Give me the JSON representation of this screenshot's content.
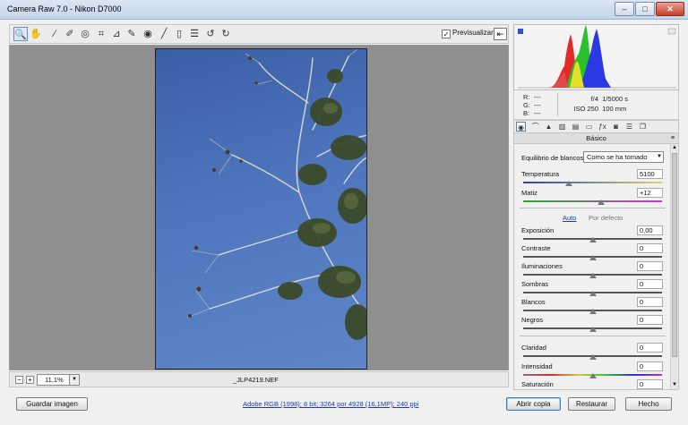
{
  "window": {
    "title": "Camera Raw 7.0 -  Nikon D7000",
    "minimize_glyph": "–",
    "maximize_glyph": "□",
    "close_glyph": "✕"
  },
  "toolbar": {
    "tools": [
      {
        "name": "zoom-tool-icon",
        "glyph": "🔍"
      },
      {
        "name": "hand-tool-icon",
        "glyph": "✋"
      },
      {
        "name": "white-balance-tool-icon",
        "glyph": "⁄"
      },
      {
        "name": "color-sampler-tool-icon",
        "glyph": "✐"
      },
      {
        "name": "target-adjustment-tool-icon",
        "glyph": "◎"
      },
      {
        "name": "crop-tool-icon",
        "glyph": "⌗"
      },
      {
        "name": "straighten-tool-icon",
        "glyph": "⊿"
      },
      {
        "name": "spot-removal-tool-icon",
        "glyph": "✎"
      },
      {
        "name": "red-eye-tool-icon",
        "glyph": "◉"
      },
      {
        "name": "adjustment-brush-icon",
        "glyph": "╱"
      },
      {
        "name": "graduated-filter-icon",
        "glyph": "▯"
      },
      {
        "name": "preferences-icon",
        "glyph": "☰"
      },
      {
        "name": "rotate-left-icon",
        "glyph": "↺"
      },
      {
        "name": "rotate-right-icon",
        "glyph": "↻"
      }
    ],
    "preview_label": "Previsualizar",
    "preview_checked": true,
    "fullscreen_glyph": "⇤"
  },
  "status": {
    "zoom": "11,1%",
    "filename": "_JLP4219.NEF"
  },
  "info": {
    "r_label": "R:",
    "g_label": "G:",
    "b_label": "B:",
    "r_value": "---",
    "g_value": "---",
    "b_value": "---",
    "aperture": "f/4",
    "shutter": "1/5000 s",
    "iso": "ISO 250",
    "focal": "100 mm"
  },
  "panel": {
    "title": "Básico",
    "menu_glyph": "≡",
    "wb_label": "Equilibrio de blancos:",
    "wb_value": "Como se ha tomado",
    "auto_label": "Auto",
    "default_label": "Por defecto",
    "sliders": [
      {
        "label": "Temperatura",
        "value": "5100",
        "level": 0.33,
        "kind": "temp"
      },
      {
        "label": "Matiz",
        "value": "+12",
        "level": 0.56,
        "kind": "tint"
      },
      {
        "label": "Exposición",
        "value": "0,00",
        "level": 0.5,
        "kind": "plain"
      },
      {
        "label": "Contraste",
        "value": "0",
        "level": 0.5,
        "kind": "plain"
      },
      {
        "label": "Iluminaciones",
        "value": "0",
        "level": 0.5,
        "kind": "plain"
      },
      {
        "label": "Sombras",
        "value": "0",
        "level": 0.5,
        "kind": "plain"
      },
      {
        "label": "Blancos",
        "value": "0",
        "level": 0.5,
        "kind": "plain"
      },
      {
        "label": "Negros",
        "value": "0",
        "level": 0.5,
        "kind": "plain"
      },
      {
        "label": "Claridad",
        "value": "0",
        "level": 0.5,
        "kind": "plain"
      },
      {
        "label": "Intensidad",
        "value": "0",
        "level": 0.5,
        "kind": "vibrance"
      },
      {
        "label": "Saturación",
        "value": "0",
        "level": 0.5,
        "kind": "plain"
      }
    ]
  },
  "buttons": {
    "save": "Guardar imagen",
    "workflow_link": "Adobe RGB (1998); 8 bit; 3264 por 4928 (16,1MP); 240 ppi",
    "open": "Abrir copia",
    "reset": "Restaurar",
    "done": "Hecho"
  },
  "colors": {
    "sky": "#4f76bd",
    "foliage": "#3b4a2a",
    "branch": "#d8d6cf"
  }
}
